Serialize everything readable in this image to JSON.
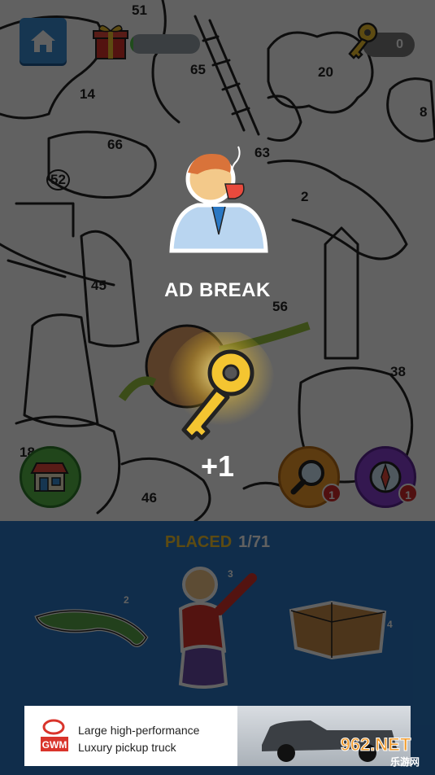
{
  "hud": {
    "progress_fraction": 0.05,
    "key_count": "0"
  },
  "board": {
    "region_numbers": [
      "51",
      "65",
      "20",
      "14",
      "8",
      "66",
      "63",
      "52",
      "2",
      "45",
      "56",
      "38",
      "46",
      "18"
    ]
  },
  "popup": {
    "title": "AD BREAK",
    "reward": "+1"
  },
  "tools": {
    "magnifier_badge": "1",
    "compass_badge": "1"
  },
  "tray": {
    "placed_label": "PLACED",
    "placed_count": "1/71",
    "pieces": [
      {
        "name": "crocodile",
        "number": "2"
      },
      {
        "name": "grandma",
        "number": "3"
      },
      {
        "name": "box",
        "number": "4"
      }
    ]
  },
  "ad": {
    "brand": "GWM",
    "line1": "Large high-performance",
    "line2": "Luxury pickup truck"
  },
  "watermark": {
    "site": "962.NET",
    "sub": "乐游网"
  },
  "colors": {
    "accent_yellow": "#f4c531",
    "tray_blue": "#2a78c4",
    "badge_red": "#d32b2b"
  }
}
